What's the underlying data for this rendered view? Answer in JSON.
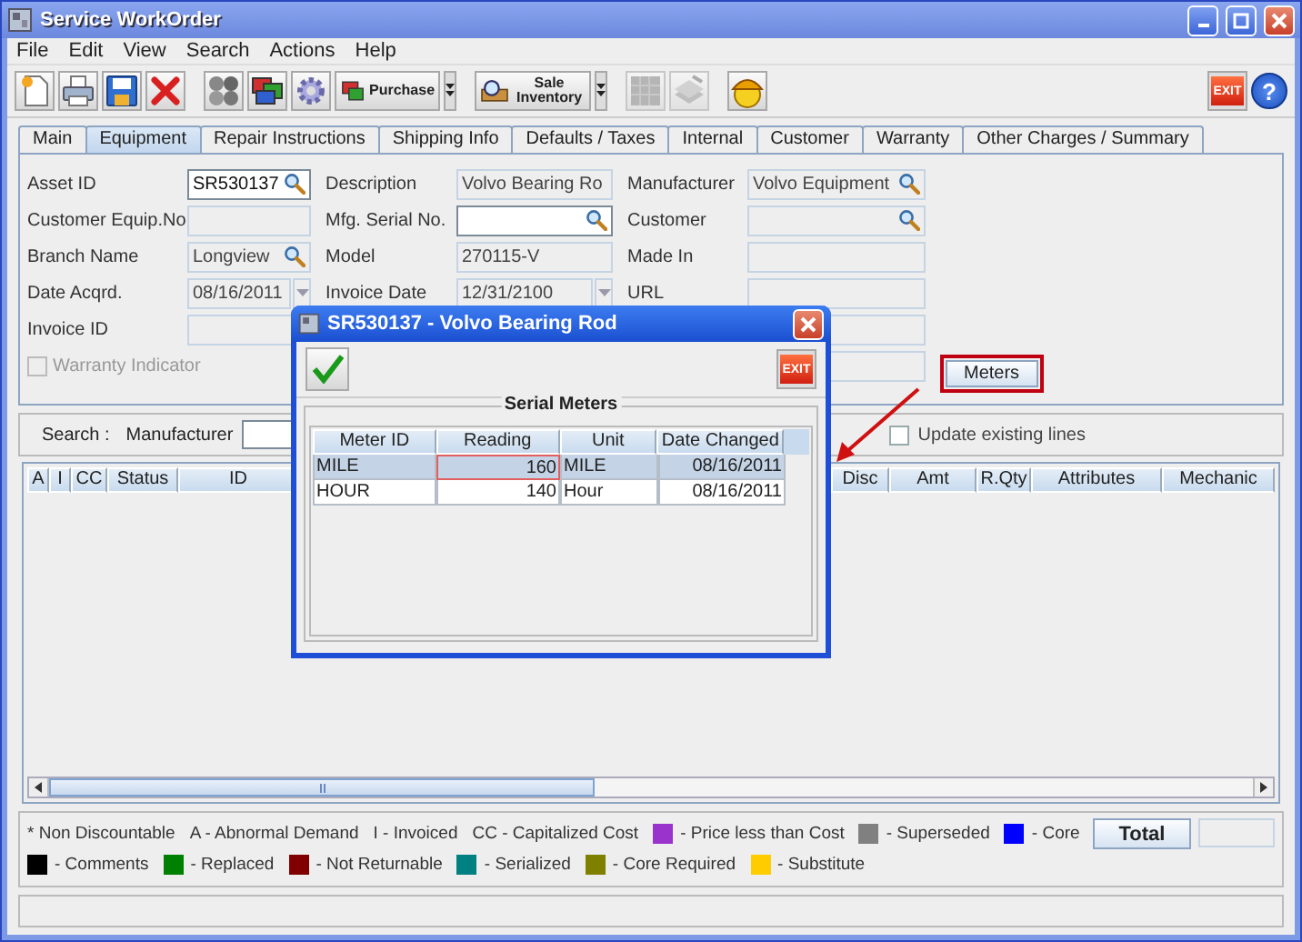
{
  "window": {
    "title": "Service WorkOrder"
  },
  "menu": [
    "File",
    "Edit",
    "View",
    "Search",
    "Actions",
    "Help"
  ],
  "toolbar": {
    "groups": [
      [
        {
          "kind": "icon",
          "disabled": false
        },
        {
          "kind": "icon",
          "disabled": false
        },
        {
          "kind": "icon",
          "disabled": false
        },
        {
          "kind": "icon",
          "disabled": false
        }
      ],
      [
        {
          "kind": "icon",
          "disabled": false
        },
        {
          "kind": "icon",
          "disabled": false
        },
        {
          "kind": "icon",
          "disabled": false
        },
        {
          "kind": "menu_button",
          "label": "Purchase"
        }
      ],
      [
        {
          "kind": "menu_button",
          "label": "Sale Inventory"
        }
      ],
      [
        {
          "kind": "icon",
          "disabled": true
        },
        {
          "kind": "icon",
          "disabled": true
        }
      ],
      [
        {
          "kind": "icon",
          "disabled": false
        }
      ]
    ],
    "right": [
      {
        "kind": "exit",
        "label": "EXIT"
      },
      {
        "kind": "help",
        "label": "?"
      }
    ]
  },
  "tabs": [
    {
      "label": "Main",
      "selected": false
    },
    {
      "label": "Equipment",
      "selected": true
    },
    {
      "label": "Repair Instructions",
      "selected": false
    },
    {
      "label": "Shipping Info",
      "selected": false
    },
    {
      "label": "Defaults / Taxes",
      "selected": false
    },
    {
      "label": "Internal",
      "selected": false
    },
    {
      "label": "Customer",
      "selected": false
    },
    {
      "label": "Warranty",
      "selected": false
    },
    {
      "label": "Other Charges / Summary",
      "selected": false
    }
  ],
  "form": {
    "columns": [
      [
        {
          "kind": "field",
          "label": "Asset ID",
          "value": "SR530137",
          "editable": true,
          "lookup": true,
          "date_picker": false
        },
        {
          "kind": "field",
          "label": "Customer Equip.No",
          "editable": false,
          "lookup": false,
          "date_picker": false
        },
        {
          "kind": "field",
          "label": "Branch Name",
          "value": "Longview",
          "editable": false,
          "lookup": true,
          "date_picker": false
        },
        {
          "kind": "field",
          "label": "Date Acqrd.",
          "value": "08/16/2011",
          "editable": false,
          "lookup": false,
          "date_picker": true
        },
        {
          "kind": "field",
          "label": "Invoice ID",
          "editable": false,
          "lookup": false,
          "date_picker": false
        },
        {
          "kind": "checkbox",
          "label": "Warranty Indicator",
          "checked": false,
          "disabled": true
        }
      ],
      [
        {
          "kind": "field",
          "label": "Description",
          "value": "Volvo Bearing Ro",
          "editable": false,
          "lookup": false,
          "date_picker": false
        },
        {
          "kind": "field",
          "label": "Mfg. Serial No.",
          "editable": true,
          "lookup": true,
          "date_picker": false
        },
        {
          "kind": "field",
          "label": "Model",
          "value": "270115-V",
          "editable": false,
          "lookup": false,
          "date_picker": false
        },
        {
          "kind": "field",
          "label": "Invoice Date",
          "value": "12/31/2100",
          "editable": false,
          "lookup": false,
          "date_picker": true
        }
      ],
      [
        {
          "kind": "field",
          "label": "Manufacturer",
          "value": "Volvo Equipment",
          "editable": false,
          "lookup": true,
          "date_picker": false
        },
        {
          "kind": "field",
          "label": "Customer",
          "editable": false,
          "lookup": true,
          "date_picker": false
        },
        {
          "kind": "field",
          "label": "Made In",
          "editable": false,
          "lookup": false,
          "date_picker": false
        },
        {
          "kind": "field",
          "label": "URL",
          "editable": false,
          "lookup": false,
          "date_picker": false
        },
        {
          "kind": "field",
          "editable": false,
          "lookup": false,
          "date_picker": false
        },
        {
          "kind": "field",
          "editable": false,
          "lookup": false,
          "date_picker": false
        }
      ]
    ],
    "meters_button": {
      "label": "Meters",
      "highlighted": true
    }
  },
  "search": {
    "label": "Search :",
    "field_label": "Manufacturer",
    "update_existing": {
      "label": "Update existing lines",
      "checked": false
    }
  },
  "table": {
    "columns_left": [
      "A",
      "I",
      "CC",
      "Status",
      "ID"
    ],
    "columns_right": [
      "Disc",
      "Amt",
      "R.Qty",
      "Attributes",
      "Mechanic"
    ]
  },
  "legend": {
    "items": [
      {
        "kind": "text",
        "label": "* Non Discountable"
      },
      {
        "kind": "text",
        "label": "A - Abnormal Demand"
      },
      {
        "kind": "text",
        "label": "I - Invoiced"
      },
      {
        "kind": "text",
        "label": "CC - Capitalized Cost"
      },
      {
        "kind": "swatch",
        "color": "#9933cc",
        "label": "- Price less than Cost"
      },
      {
        "kind": "swatch",
        "color": "#808080",
        "label": "- Superseded"
      },
      {
        "kind": "swatch",
        "color": "#0000ff",
        "label": "- Core"
      },
      {
        "kind": "swatch",
        "color": "#000000",
        "label": "- Comments"
      },
      {
        "kind": "swatch",
        "color": "#008000",
        "label": "- Replaced"
      },
      {
        "kind": "swatch",
        "color": "#800000",
        "label": "- Not Returnable"
      },
      {
        "kind": "swatch",
        "color": "#008080",
        "label": "- Serialized"
      },
      {
        "kind": "swatch",
        "color": "#808000",
        "label": "- Core Required"
      },
      {
        "kind": "swatch",
        "color": "#ffcc00",
        "label": "- Substitute"
      }
    ],
    "total_button": {
      "label": "Total"
    }
  },
  "dialog": {
    "title": "SR530137 - Volvo Bearing Rod",
    "exit_label": "EXIT",
    "group_title": "Serial Meters",
    "columns": [
      "Meter ID",
      "Reading",
      "Unit",
      "Date Changed"
    ],
    "rows": [
      {
        "selected": true,
        "cells": [
          {
            "text": "MILE",
            "focused": false
          },
          {
            "text": "160",
            "focused": true
          },
          {
            "text": "MILE",
            "focused": false
          },
          {
            "text": "08/16/2011",
            "focused": false
          }
        ]
      },
      {
        "selected": false,
        "cells": [
          {
            "text": "HOUR",
            "focused": false
          },
          {
            "text": "140",
            "focused": false
          },
          {
            "text": "Hour",
            "focused": false
          },
          {
            "text": "08/16/2011",
            "focused": false
          }
        ]
      }
    ]
  }
}
